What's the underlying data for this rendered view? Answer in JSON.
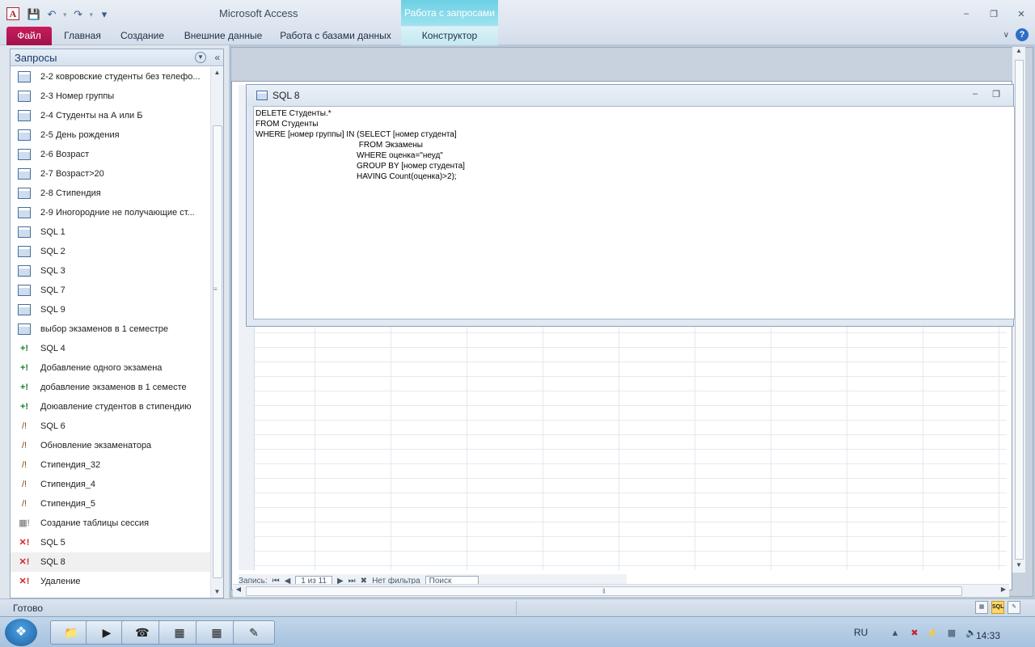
{
  "window": {
    "app_title": "Microsoft Access",
    "context_tab_header": "Работа с запросами",
    "minimize": "–",
    "restore": "❐",
    "close": "✕"
  },
  "ribbon_tabs": {
    "file": "Файл",
    "home": "Главная",
    "create": "Создание",
    "external_data": "Внешние данные",
    "database_tools": "Работа с базами данных",
    "designer": "Конструктор"
  },
  "nav_pane": {
    "title": "Запросы",
    "items": [
      {
        "label": "2-2 ковровские студенты без телефо...",
        "type": "select"
      },
      {
        "label": "2-3 Номер группы",
        "type": "select"
      },
      {
        "label": "2-4 Студенты на А или Б",
        "type": "select"
      },
      {
        "label": "2-5 День рождения",
        "type": "select"
      },
      {
        "label": "2-6 Возраст",
        "type": "select"
      },
      {
        "label": "2-7 Возраст>20",
        "type": "select"
      },
      {
        "label": "2-8  Стипендия",
        "type": "select"
      },
      {
        "label": "2-9 Иногородние не получающие ст...",
        "type": "select"
      },
      {
        "label": "SQL 1",
        "type": "select"
      },
      {
        "label": "SQL 2",
        "type": "select"
      },
      {
        "label": "SQL 3",
        "type": "select"
      },
      {
        "label": "SQL 7",
        "type": "select"
      },
      {
        "label": "SQL 9",
        "type": "select"
      },
      {
        "label": "выбор экзаменов в 1 семестре",
        "type": "select"
      },
      {
        "label": "SQL 4",
        "type": "append"
      },
      {
        "label": "Добавление одного экзамена",
        "type": "append"
      },
      {
        "label": "добавление экзаменов в 1 семесте",
        "type": "append"
      },
      {
        "label": "Доюавление студентов в стипендию",
        "type": "append"
      },
      {
        "label": "SQL 6",
        "type": "update"
      },
      {
        "label": "Обновление экзаменатора",
        "type": "update"
      },
      {
        "label": "Стипендия_32",
        "type": "update"
      },
      {
        "label": "Стипендия_4",
        "type": "update"
      },
      {
        "label": "Стипендия_5",
        "type": "update"
      },
      {
        "label": "Создание таблицы сессия",
        "type": "make"
      },
      {
        "label": "SQL 5",
        "type": "delete"
      },
      {
        "label": "SQL 8",
        "type": "delete",
        "selected": true
      },
      {
        "label": "Удаление",
        "type": "delete"
      }
    ]
  },
  "sql_window": {
    "title": "SQL 8",
    "lines": [
      "DELETE Студенты.*",
      "FROM Студенты",
      "WHERE [номер группы] IN (SELECT [номер студента]",
      "                                              FROM Экзамены",
      "                                             WHERE оценка=\"неуд\"",
      "                                             GROUP BY [номер студента]",
      "                                             HAVING Count(оценка)>2);"
    ]
  },
  "record_nav": {
    "label": "Запись:",
    "position": "1 из 11",
    "filter": "Нет фильтра",
    "search": "Поиск"
  },
  "status_bar": {
    "status": "Готово",
    "sql_view": "SQL"
  },
  "taskbar": {
    "language": "RU",
    "clock": "14:33"
  },
  "colors": {
    "file_tab": "#b5164f",
    "context_tab": "#7fd8ea",
    "sql_view_active": "#ffd766"
  }
}
